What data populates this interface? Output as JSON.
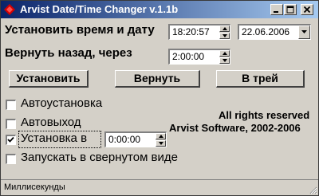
{
  "window": {
    "title": "Arvist Date/Time Changer v.1.1b",
    "title_color": "#ffffff",
    "titlebar_color": "#0a246a",
    "icon": "app-diamond-icon",
    "controls": [
      "minimize-icon",
      "maximize-icon",
      "close-icon"
    ]
  },
  "set_time": {
    "label": "Установить время и дату",
    "time_value": "18:20:57",
    "date_value": "22.06.2006"
  },
  "revert": {
    "label": "Вернуть назад, через",
    "delay_value": "2:00:00"
  },
  "buttons": {
    "set_label": "Установить",
    "revert_label": "Вернуть",
    "tray_label": "В трей"
  },
  "options": {
    "autoset": {
      "label": "Автоустановка",
      "checked": false
    },
    "autoexit": {
      "label": "Автовыход",
      "checked": false
    },
    "set_in": {
      "label": "Установка в",
      "checked": true,
      "time_value": "0:00:00"
    },
    "minimized": {
      "label": "Запускать в свернутом виде",
      "checked": false
    }
  },
  "copyright": {
    "line1": "All rights reserved",
    "line2": "Arvist Software, 2002-2006"
  },
  "status": {
    "text": "Миллисекунды"
  }
}
